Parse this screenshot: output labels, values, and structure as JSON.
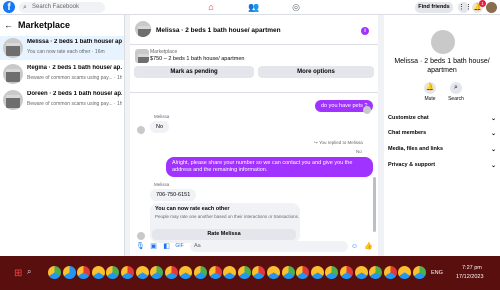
{
  "topbar": {
    "logo": "f",
    "search_placeholder": "Search Facebook",
    "find_friends": "Find friends",
    "notification_count": "1"
  },
  "left": {
    "title": "Marketplace",
    "conversations": [
      {
        "title": "Melissa · 2 beds 1 bath house/ apa...",
        "subtitle": "You can now rate each other · 16m"
      },
      {
        "title": "Regina · 2 beds 1 bath house/ ap...",
        "subtitle": "Beware of common scams using pay... · 1h"
      },
      {
        "title": "Doreen · 2 beds 1 bath house/ ap...",
        "subtitle": "Beware of common scams using pay... · 1h"
      }
    ]
  },
  "chat": {
    "title": "Melissa · 2 beds 1 bath house/ apartmen",
    "listing_label": "Marketplace",
    "listing_price": "$750 – 2 beds 1 bath house/ apartmen",
    "mark_pending": "Mark as pending",
    "more_options": "More options",
    "messages": {
      "pets_question": "do you have pets ?",
      "sender1": "Melissa",
      "reply_no": "No",
      "replied_label": "You replied to Melissa",
      "quoted_no": "No",
      "request": "Alright, please share your number so we can contact you and give you the address and the remaining information.",
      "sender2": "Melissa",
      "phone": "706-750-6151",
      "rate_title": "You can now rate each other",
      "rate_desc": "People may rate one another based on their interactions or transactions.",
      "rate_button": "Rate Melissa"
    },
    "composer_placeholder": "Aa"
  },
  "right": {
    "name": "Melissa · 2 beds 1 bath house/ apartmen",
    "mute": "Mute",
    "search": "Search",
    "sections": [
      "Customize chat",
      "Chat members",
      "Media, files and links",
      "Privacy & support"
    ]
  },
  "taskbar": {
    "time": "7:27 pm",
    "date": "17/12/2023",
    "lang": "ENG",
    "app_colors": [
      "#4caf50",
      "#2196f3",
      "#e53935",
      "#fbc02d",
      "#4caf50",
      "#e53935",
      "#fbc02d",
      "#4caf50",
      "#e53935",
      "#fbc02d",
      "#4caf50",
      "#e53935",
      "#fbc02d",
      "#4caf50",
      "#e53935",
      "#fbc02d",
      "#4caf50",
      "#e53935",
      "#fbc02d",
      "#4caf50",
      "#e53935",
      "#fbc02d",
      "#4caf50",
      "#e53935",
      "#fbc02d",
      "#4caf50"
    ]
  },
  "colors": {
    "accent": "#a033ff",
    "brand": "#1877f2",
    "taskbar": "#5a0f0f"
  }
}
